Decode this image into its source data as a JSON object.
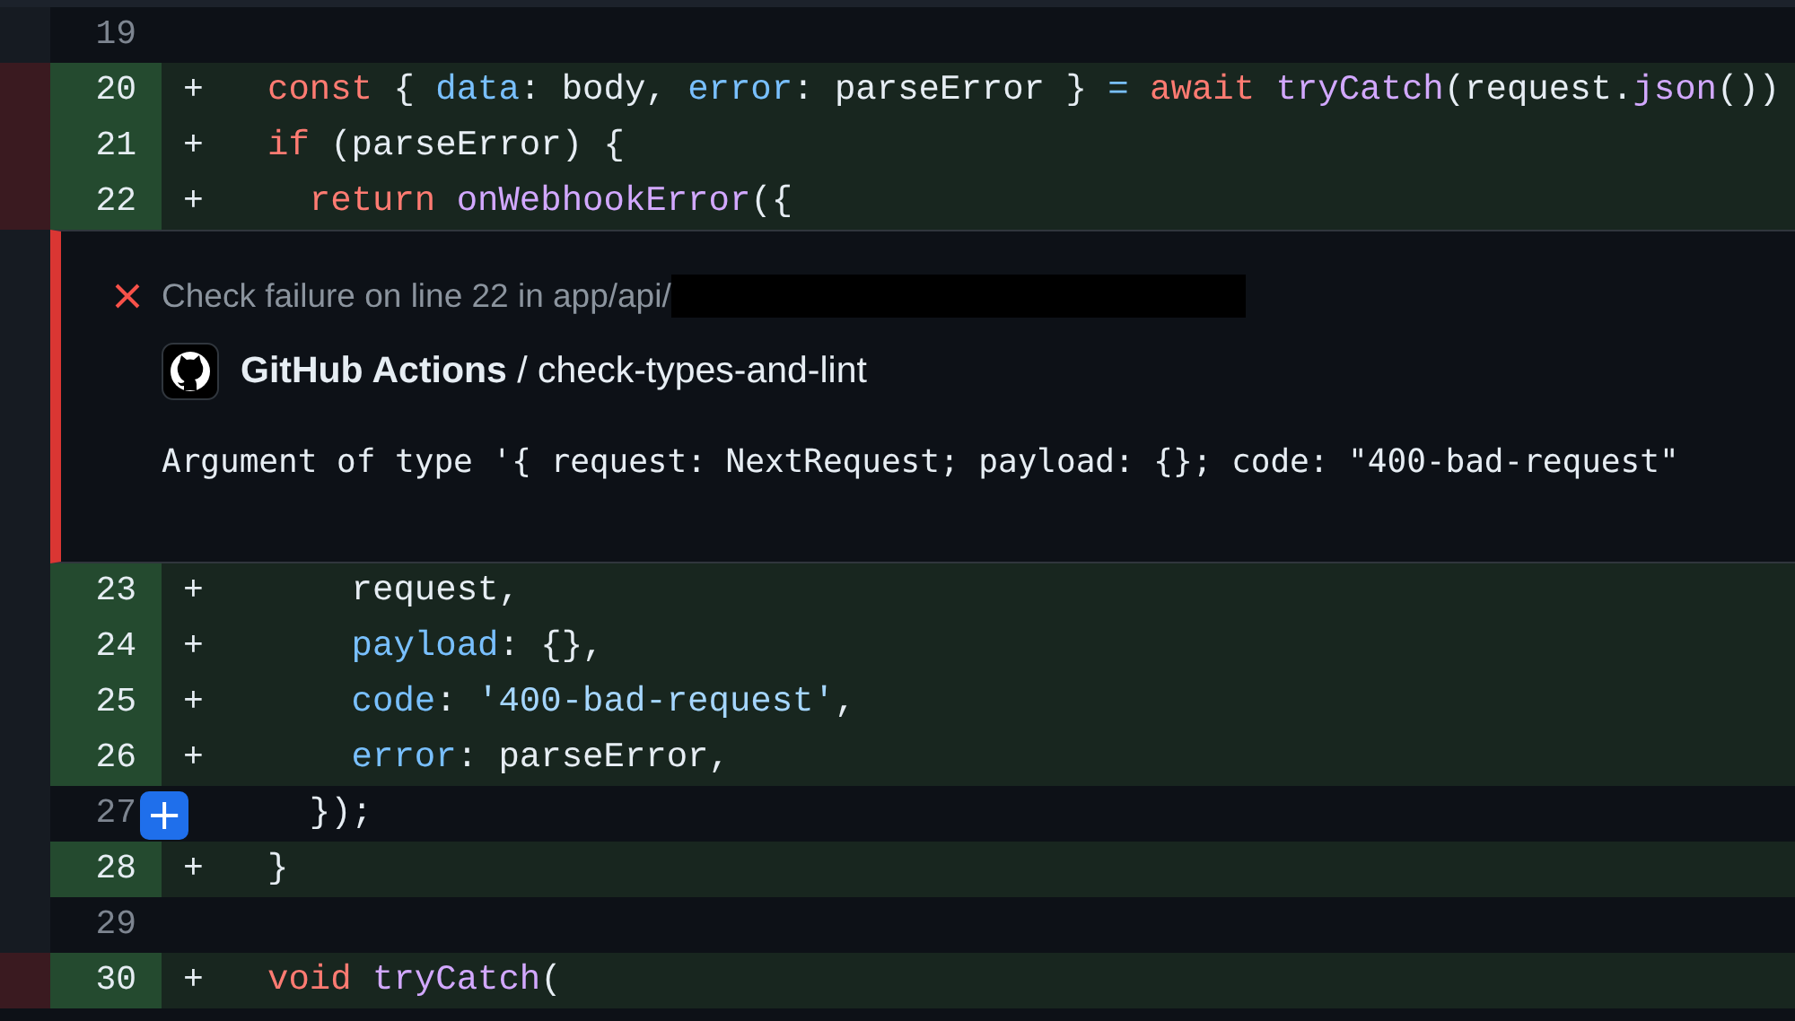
{
  "diff_lines_before": [
    {
      "number": "19",
      "added": false,
      "removed_left": false
    },
    {
      "number": "20",
      "added": true,
      "removed_left": true,
      "marker": "+",
      "tokens": [
        {
          "kind": "keyword",
          "text": "const "
        },
        {
          "kind": "plain",
          "text": "{ "
        },
        {
          "kind": "prop",
          "text": "data"
        },
        {
          "kind": "plain",
          "text": ": body, "
        },
        {
          "kind": "prop",
          "text": "error"
        },
        {
          "kind": "plain",
          "text": ": parseError } "
        },
        {
          "kind": "prop",
          "text": "= "
        },
        {
          "kind": "keyword",
          "text": "await "
        },
        {
          "kind": "func",
          "text": "tryCatch"
        },
        {
          "kind": "plain",
          "text": "(request."
        },
        {
          "kind": "func",
          "text": "json"
        },
        {
          "kind": "plain",
          "text": "())"
        }
      ]
    },
    {
      "number": "21",
      "added": true,
      "removed_left": true,
      "marker": "+",
      "tokens": [
        {
          "kind": "keyword",
          "text": "if "
        },
        {
          "kind": "plain",
          "text": "(parseError) {"
        }
      ]
    },
    {
      "number": "22",
      "added": true,
      "removed_left": true,
      "marker": "+",
      "tokens": [
        {
          "kind": "keyword",
          "text": "  return "
        },
        {
          "kind": "func",
          "text": "onWebhookError"
        },
        {
          "kind": "plain",
          "text": "({"
        }
      ]
    }
  ],
  "annotation": {
    "heading": "Check failure on line 22 in app/api/",
    "source": "**GitHub Actions** / check-types-and-lint",
    "message": "Argument of type '{ request: NextRequest; payload: {}; code: \"400-bad-request\""
  },
  "diff_lines_after": [
    {
      "number": "23",
      "added": true,
      "removed_left": false,
      "marker": "+",
      "tokens": [
        {
          "kind": "plain",
          "text": "    request,"
        }
      ]
    },
    {
      "number": "24",
      "added": true,
      "removed_left": false,
      "marker": "+",
      "tokens": [
        {
          "kind": "prop",
          "text": "    payload"
        },
        {
          "kind": "plain",
          "text": ": {},"
        }
      ]
    },
    {
      "number": "25",
      "added": true,
      "removed_left": false,
      "marker": "+",
      "tokens": [
        {
          "kind": "prop",
          "text": "    code"
        },
        {
          "kind": "plain",
          "text": ": "
        },
        {
          "kind": "string",
          "text": "'400-bad-request'"
        },
        {
          "kind": "plain",
          "text": ","
        }
      ]
    },
    {
      "number": "26",
      "added": true,
      "removed_left": false,
      "marker": "+",
      "tokens": [
        {
          "kind": "prop",
          "text": "    error"
        },
        {
          "kind": "plain",
          "text": ": parseError,"
        }
      ]
    },
    {
      "number": "27",
      "added": false,
      "removed_left": false,
      "comment_button": "+",
      "tokens": [
        {
          "kind": "plain",
          "text": "  });"
        }
      ]
    },
    {
      "number": "28",
      "added": true,
      "removed_left": false,
      "marker": "+",
      "tokens": [
        {
          "kind": "plain",
          "text": "}"
        }
      ]
    },
    {
      "number": "29",
      "added": false,
      "removed_left": false
    },
    {
      "number": "30",
      "added": true,
      "removed_left": true,
      "marker": "+",
      "tokens": [
        {
          "kind": "keyword",
          "text": "void "
        },
        {
          "kind": "func",
          "text": "tryCatch"
        },
        {
          "kind": "plain",
          "text": "("
        }
      ]
    }
  ]
}
